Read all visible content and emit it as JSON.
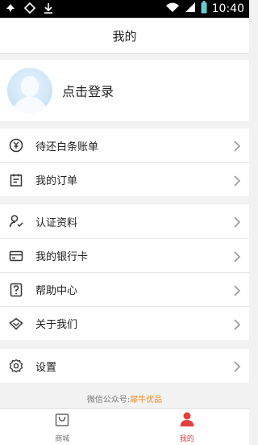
{
  "status_bar": {
    "time": "10:40",
    "icons": [
      "app-icon-1",
      "app-icon-2",
      "download-icon",
      "wifi-icon",
      "signal-icon",
      "battery-icon"
    ]
  },
  "nav": {
    "title": "我的"
  },
  "profile": {
    "login_label": "点击登录"
  },
  "group1": [
    {
      "label": "待还白条账单",
      "icon": "bill-icon"
    },
    {
      "label": "我的订单",
      "icon": "orders-icon"
    }
  ],
  "group2": [
    {
      "label": "认证资料",
      "icon": "verify-icon"
    },
    {
      "label": "我的银行卡",
      "icon": "bank-card-icon"
    },
    {
      "label": "帮助中心",
      "icon": "help-icon"
    },
    {
      "label": "关于我们",
      "icon": "about-icon"
    }
  ],
  "group3": [
    {
      "label": "设置",
      "icon": "settings-icon"
    }
  ],
  "footer": {
    "prefix": "微信公众号:",
    "account": "犀牛优品"
  },
  "tabs": [
    {
      "label": "商城",
      "icon": "shop-bag-icon",
      "active": false
    },
    {
      "label": "我的",
      "icon": "user-icon",
      "active": true
    }
  ],
  "colors": {
    "accent_red": "#e43f3f",
    "accent_orange": "#f08a1c"
  }
}
